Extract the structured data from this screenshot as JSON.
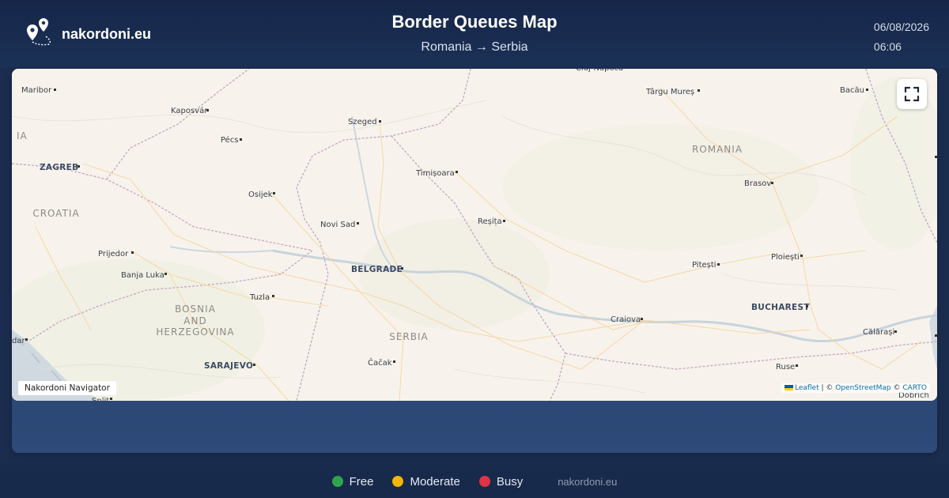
{
  "header": {
    "brand": "nakordoni.eu",
    "title": "Border Queues Map",
    "route": "Romania → Serbia",
    "date": "06/08/2026",
    "time": "06:06"
  },
  "map": {
    "badge": "Nakordoni Navigator",
    "attribution": {
      "leaflet": "Leaflet",
      "sep1": " | © ",
      "osm": "OpenStreetMap",
      "sep2": " © ",
      "carto": "CARTO"
    },
    "fullscreen_icon": "expand-icon",
    "countries": [
      "ROMANIA",
      "CROATIA",
      "BOSNIA",
      "AND",
      "HERZEGOVINA",
      "SERBIA"
    ],
    "capitals": [
      "ZAGREB",
      "BELGRADE",
      "BUCHAREST",
      "SARAJEVO"
    ],
    "cities": [
      "Cluj-Napoca",
      "Maribor",
      "Târgu Mureș",
      "Bacău",
      "Kaposvár",
      "Szeged",
      "Pécs",
      "Timișoara",
      "Brasov",
      "Osijek",
      "Novi Sad",
      "Reșița",
      "Prijedor",
      "Pitești",
      "Ploiești",
      "Banja Luka",
      "Tuzla",
      "Craiova",
      "Călărași",
      "Čačak",
      "Ruse",
      "Split",
      "Dobrich",
      "dar"
    ]
  },
  "footer": {
    "legend": [
      {
        "label": "Free",
        "color": "#2ea44f"
      },
      {
        "label": "Moderate",
        "color": "#f2b705"
      },
      {
        "label": "Busy",
        "color": "#dc3545"
      }
    ],
    "site": "nakordoni.eu"
  }
}
